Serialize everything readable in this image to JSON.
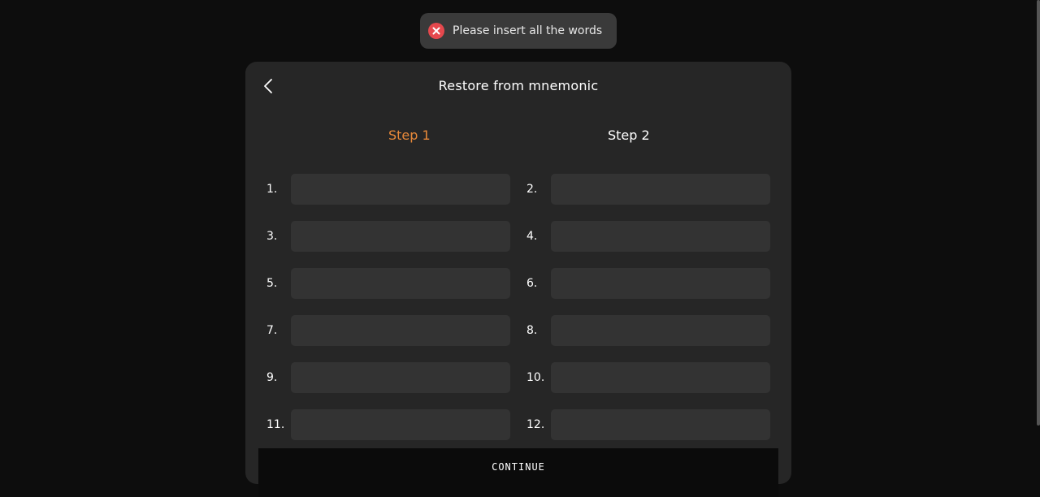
{
  "toast": {
    "message": "Please insert all the words",
    "icon": "error-x-icon",
    "color": "#e5484d"
  },
  "card": {
    "title": "Restore from mnemonic",
    "back_icon": "chevron-left-icon"
  },
  "steps": [
    {
      "label": "Step 1",
      "active": true,
      "color": "#e8893a"
    },
    {
      "label": "Step 2",
      "active": false,
      "color": "#ffffff"
    }
  ],
  "words": [
    {
      "number": "1.",
      "value": ""
    },
    {
      "number": "2.",
      "value": ""
    },
    {
      "number": "3.",
      "value": ""
    },
    {
      "number": "4.",
      "value": ""
    },
    {
      "number": "5.",
      "value": ""
    },
    {
      "number": "6.",
      "value": ""
    },
    {
      "number": "7.",
      "value": ""
    },
    {
      "number": "8.",
      "value": ""
    },
    {
      "number": "9.",
      "value": ""
    },
    {
      "number": "10.",
      "value": ""
    },
    {
      "number": "11.",
      "value": ""
    },
    {
      "number": "12.",
      "value": ""
    }
  ],
  "continue_label": "CONTINUE"
}
